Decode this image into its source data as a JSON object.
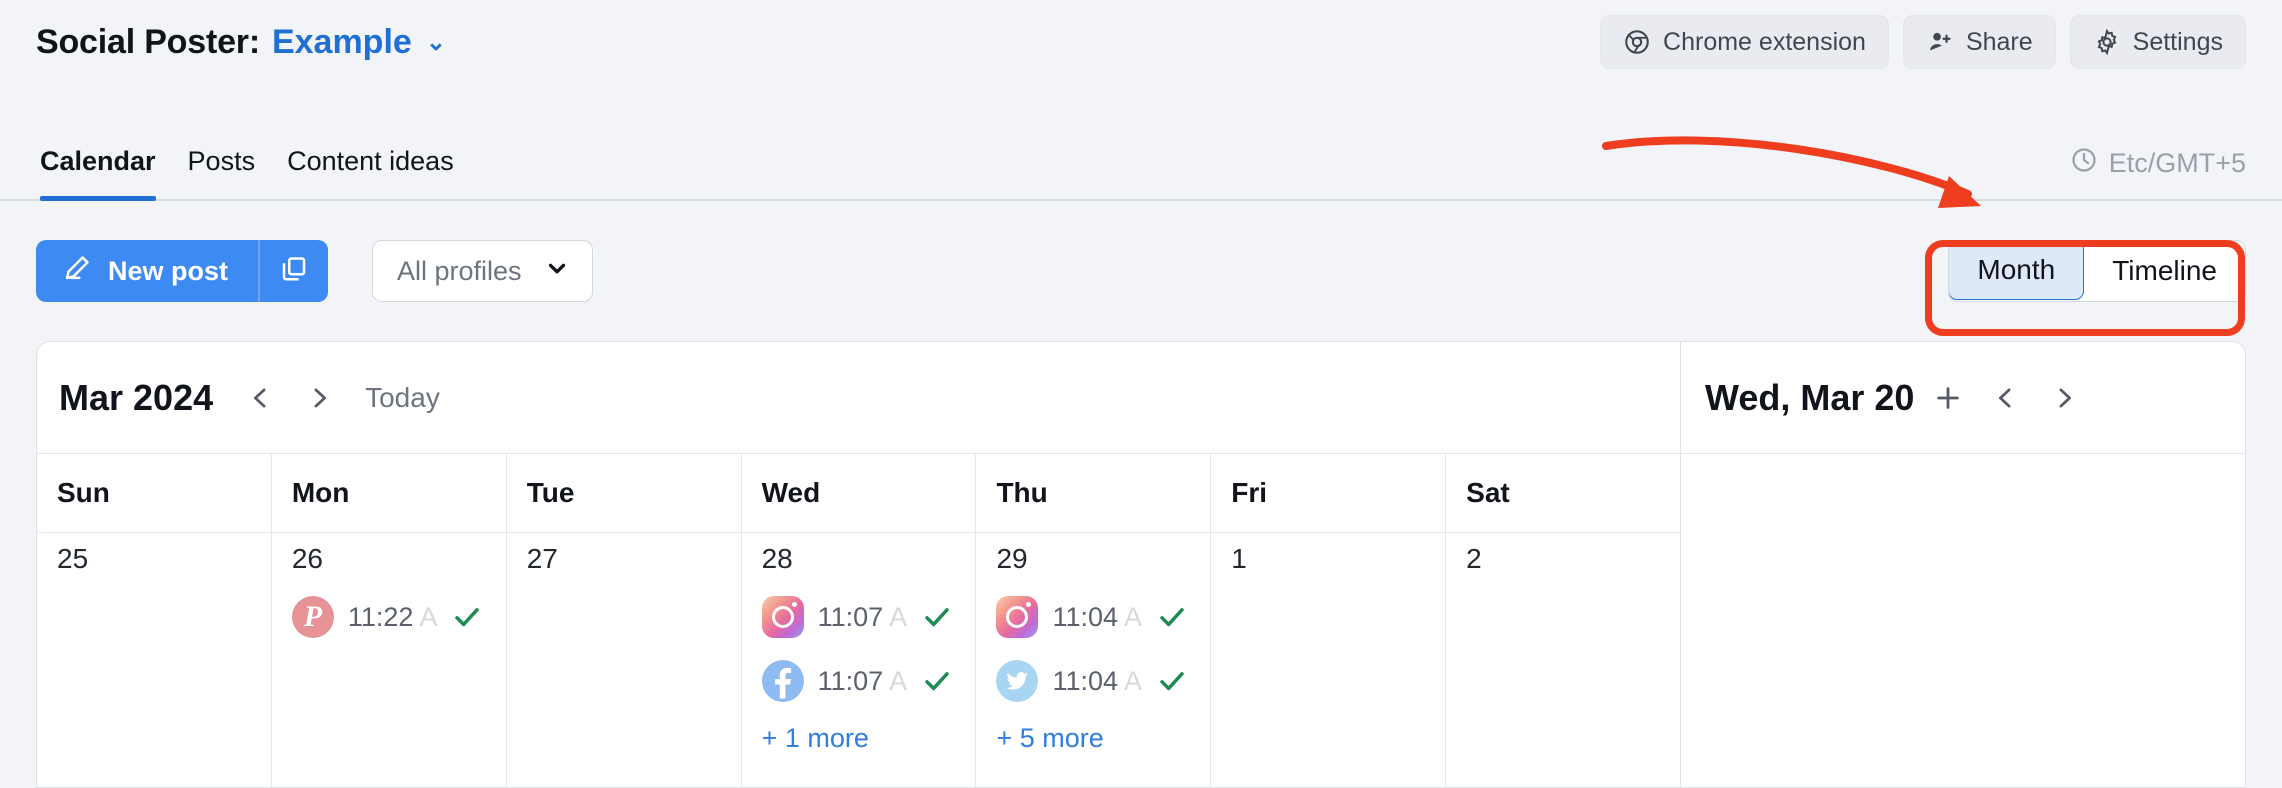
{
  "header": {
    "title": "Social Poster:",
    "project": "Example",
    "caret_icon": "chevron-down-icon",
    "actions": [
      {
        "label": "Chrome extension",
        "icon": "chrome-icon"
      },
      {
        "label": "Share",
        "icon": "user-plus-icon"
      },
      {
        "label": "Settings",
        "icon": "gear-icon"
      }
    ]
  },
  "tabs": {
    "items": [
      {
        "label": "Calendar",
        "active": true
      },
      {
        "label": "Posts",
        "active": false
      },
      {
        "label": "Content ideas",
        "active": false
      }
    ],
    "timezone": "Etc/GMT+5",
    "timezone_icon": "clock-icon"
  },
  "toolbar": {
    "new_post_label": "New post",
    "new_post_icon": "pencil-icon",
    "duplicate_icon": "copy-icon",
    "profiles_value": "All profiles",
    "profiles_caret_icon": "chevron-down-icon",
    "view_toggle": [
      {
        "label": "Month",
        "active": true
      },
      {
        "label": "Timeline",
        "active": false
      }
    ]
  },
  "annotations": {
    "highlight_color": "#ef3d1f",
    "arrow": "curved-arrow-pointing-to-view-toggle"
  },
  "calendar": {
    "month_label": "Mar 2024",
    "prev_icon": "chevron-left-icon",
    "next_icon": "chevron-right-icon",
    "today_label": "Today",
    "weekdays": [
      "Sun",
      "Mon",
      "Tue",
      "Wed",
      "Thu",
      "Fri",
      "Sat"
    ],
    "days": [
      {
        "number": "25",
        "events": [],
        "more": null
      },
      {
        "number": "26",
        "events": [
          {
            "network": "pinterest",
            "time": "11:22",
            "ampm": "A",
            "status_icon": "check-icon"
          }
        ],
        "more": null
      },
      {
        "number": "27",
        "events": [],
        "more": null
      },
      {
        "number": "28",
        "events": [
          {
            "network": "instagram",
            "time": "11:07",
            "ampm": "A",
            "status_icon": "check-icon"
          },
          {
            "network": "facebook",
            "time": "11:07",
            "ampm": "A",
            "status_icon": "check-icon"
          }
        ],
        "more": "+ 1 more"
      },
      {
        "number": "29",
        "events": [
          {
            "network": "instagram",
            "time": "11:04",
            "ampm": "A",
            "status_icon": "check-icon"
          },
          {
            "network": "twitter",
            "time": "11:04",
            "ampm": "A",
            "status_icon": "check-icon"
          }
        ],
        "more": "+ 5 more"
      },
      {
        "number": "1",
        "events": [],
        "more": null
      },
      {
        "number": "2",
        "events": [],
        "more": null
      }
    ]
  },
  "day_panel": {
    "title": "Wed, Mar 20",
    "add_icon": "plus-icon",
    "prev_icon": "chevron-left-icon",
    "next_icon": "chevron-right-icon"
  }
}
